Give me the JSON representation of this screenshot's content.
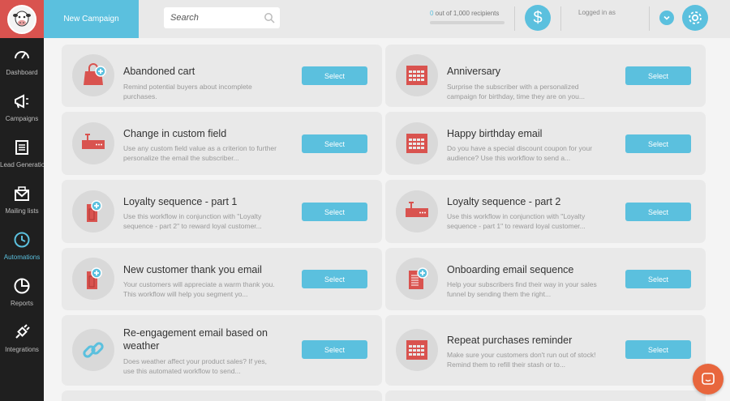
{
  "topbar": {
    "new_campaign_label": "New Campaign",
    "search_placeholder": "Search",
    "recipients_count": "0",
    "recipients_text": " out of 1,000 recipients",
    "recipients_progress": 0,
    "dollar_symbol": "$",
    "logged_in_text": "Logged in as"
  },
  "sidebar": {
    "items": [
      {
        "label": "Dashboard",
        "icon": "dashboard-icon"
      },
      {
        "label": "Campaigns",
        "icon": "megaphone-icon"
      },
      {
        "label": "Lead Generation",
        "icon": "form-icon"
      },
      {
        "label": "Mailing lists",
        "icon": "mail-icon"
      },
      {
        "label": "Automations",
        "icon": "clock-icon",
        "active": true
      },
      {
        "label": "Reports",
        "icon": "pie-chart-icon"
      },
      {
        "label": "Integrations",
        "icon": "plug-icon"
      }
    ]
  },
  "cards": [
    {
      "title": "Abandoned cart",
      "desc": "Remind potential buyers about incomplete purchases.",
      "icon": "shopping-bag-icon",
      "button": "Select"
    },
    {
      "title": "Anniversary",
      "desc": "Surprise the subscriber with a personalized campaign for birthday, time they are on you...",
      "icon": "calendar-icon",
      "button": "Select"
    },
    {
      "title": "Change in custom field",
      "desc": "Use any custom field value as a criterion to further personalize the email the subscriber...",
      "icon": "tag-field-icon",
      "button": "Select"
    },
    {
      "title": "Happy birthday email",
      "desc": "Do you have a special discount coupon for your audience? Use this workflow to send a...",
      "icon": "calendar-icon",
      "button": "Select"
    },
    {
      "title": "Loyalty sequence - part 1",
      "desc": "Use this workflow in conjunction with \"Loyalty sequence - part 2\" to reward loyal customer...",
      "icon": "tag-add-icon",
      "button": "Select"
    },
    {
      "title": "Loyalty sequence - part 2",
      "desc": "Use this workflow in conjunction with \"Loyalty sequence - part 1\" to reward loyal customer...",
      "icon": "tag-field-icon",
      "button": "Select"
    },
    {
      "title": "New customer thank you email",
      "desc": "Your customers will appreciate a warm thank you. This workflow will help you segment yo...",
      "icon": "tag-add-icon",
      "button": "Select"
    },
    {
      "title": "Onboarding email sequence",
      "desc": "Help your subscribers find their way in your sales funnel by sending them the right...",
      "icon": "document-add-icon",
      "button": "Select"
    },
    {
      "title": "Re-engagement email based on weather",
      "desc": "Does weather affect your product sales? If yes, use this automated workflow to send...",
      "icon": "link-icon",
      "button": "Select"
    },
    {
      "title": "Repeat purchases reminder",
      "desc": "Make sure your customers don't run out of stock! Remind them to refill their stash or to...",
      "icon": "calendar-icon",
      "button": "Select"
    }
  ],
  "colors": {
    "accent": "#5bc0de",
    "brand_red": "#d9534f",
    "sidebar_bg": "#1f1f1f",
    "chat": "#e8663d"
  }
}
